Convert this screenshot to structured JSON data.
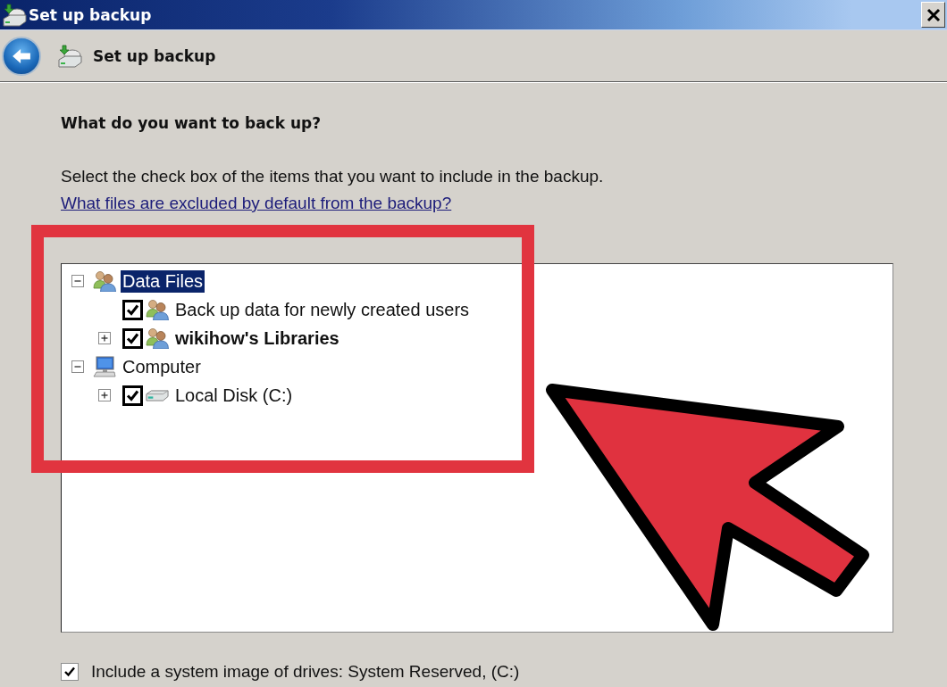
{
  "window": {
    "title": "Set up backup"
  },
  "header": {
    "title": "Set up backup"
  },
  "heading": "What do you want to back up?",
  "instructions": {
    "text": "Select the check box of the items that you want to include in the backup.",
    "link": "What files are excluded by default from the backup?"
  },
  "tree": {
    "items": [
      {
        "kind": "group",
        "label": "Data Files",
        "expanded": true,
        "selected": true,
        "children": [
          {
            "kind": "user",
            "label": "Back up data for newly created users",
            "checked": true,
            "selected": false
          },
          {
            "kind": "library",
            "label": "wikihow's Libraries",
            "checked": true,
            "expanded": false,
            "selected": false
          }
        ]
      },
      {
        "kind": "computer",
        "label": "Computer",
        "expanded": true,
        "selected": false,
        "children": [
          {
            "kind": "drive",
            "label": "Local Disk (C:)",
            "checked": true,
            "expanded": false,
            "selected": false
          }
        ]
      }
    ]
  },
  "system_image": {
    "label": "Include a system image of drives: System Reserved, (C:)",
    "checked": true
  }
}
